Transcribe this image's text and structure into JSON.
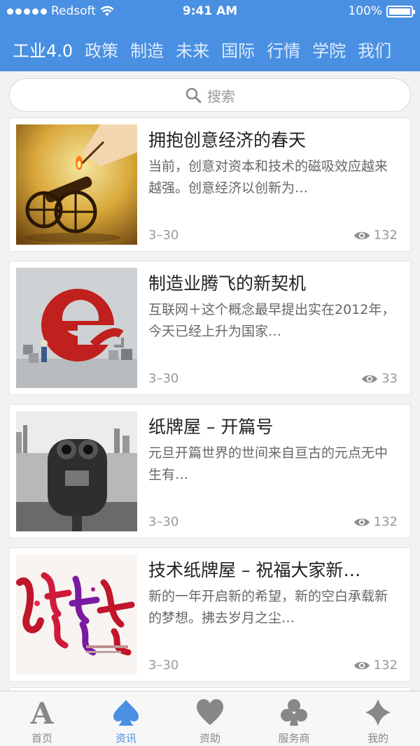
{
  "status_bar": {
    "carrier": "Redsoft",
    "time": "9:41 AM",
    "battery": "100%"
  },
  "nav": {
    "items": [
      {
        "label": "工业4.0",
        "active": true
      },
      {
        "label": "政策"
      },
      {
        "label": "制造"
      },
      {
        "label": "未来"
      },
      {
        "label": "国际"
      },
      {
        "label": "行情"
      },
      {
        "label": "学院"
      },
      {
        "label": "我们"
      }
    ]
  },
  "search": {
    "placeholder": "搜索",
    "icon": "search-icon"
  },
  "articles": [
    {
      "title": "拥抱创意经济的春天",
      "summary": "当前，创意对资本和技术的磁吸效应越来越强。创意经济以创新为…",
      "date": "3–30",
      "views": "132",
      "image": "matchstick-cannon"
    },
    {
      "title": "制造业腾飞的新契机",
      "summary": "互联网＋这个概念最早提出实在2012年，今天已经上升为国家…",
      "date": "3–30",
      "views": "33",
      "image": "red-e-letter"
    },
    {
      "title": "纸牌屋 – 开篇号",
      "summary": "元旦开篇世界的世间来自亘古的元点无中生有…",
      "date": "3–30",
      "views": "132",
      "image": "binocular-viewer"
    },
    {
      "title": "技术纸牌屋 – 祝福大家新…",
      "summary": "新的一年开启新的希望，新的空白承载新的梦想。拂去岁月之尘…",
      "date": "3–30",
      "views": "132",
      "image": "new-year-calligraphy"
    }
  ],
  "tabbar": {
    "items": [
      {
        "label": "首页",
        "icon": "letter-a-icon"
      },
      {
        "label": "资讯",
        "icon": "spade-icon",
        "active": true
      },
      {
        "label": "资助",
        "icon": "heart-icon"
      },
      {
        "label": "服务商",
        "icon": "club-icon"
      },
      {
        "label": "我的",
        "icon": "diamond-icon"
      }
    ]
  },
  "colors": {
    "accent": "#4a90e2",
    "background": "#f2f2f2",
    "tab_inactive": "#888888"
  }
}
